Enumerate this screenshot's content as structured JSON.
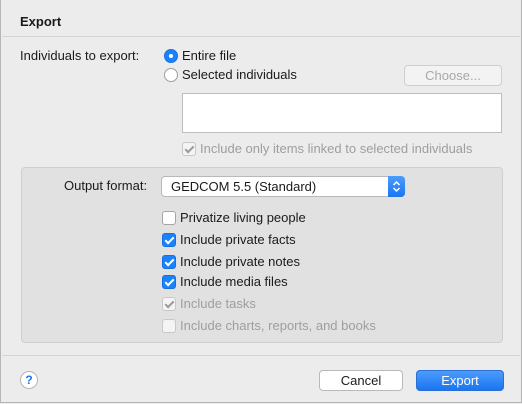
{
  "dialog": {
    "title": "Export"
  },
  "individuals": {
    "label": "Individuals to export:",
    "option_entire": "Entire file",
    "option_selected": "Selected individuals",
    "choose_button": "Choose...",
    "linked_label": "Include only items linked to selected individuals"
  },
  "format": {
    "label": "Output format:",
    "selected_value": "GEDCOM 5.5 (Standard)"
  },
  "options": {
    "privatize_living": "Privatize living people",
    "private_facts": "Include private facts",
    "private_notes": "Include private notes",
    "media_files": "Include media files",
    "tasks": "Include tasks",
    "charts": "Include charts, reports, and books"
  },
  "footer": {
    "help_label": "?",
    "cancel_button": "Cancel",
    "export_button": "Export"
  },
  "colors": {
    "accent": "#1a82fb",
    "disabled_text": "#9e9e9e",
    "background": "#ececec"
  },
  "icons": {
    "help": "question-mark-icon",
    "select_arrows": "updown-chevron-icon"
  }
}
